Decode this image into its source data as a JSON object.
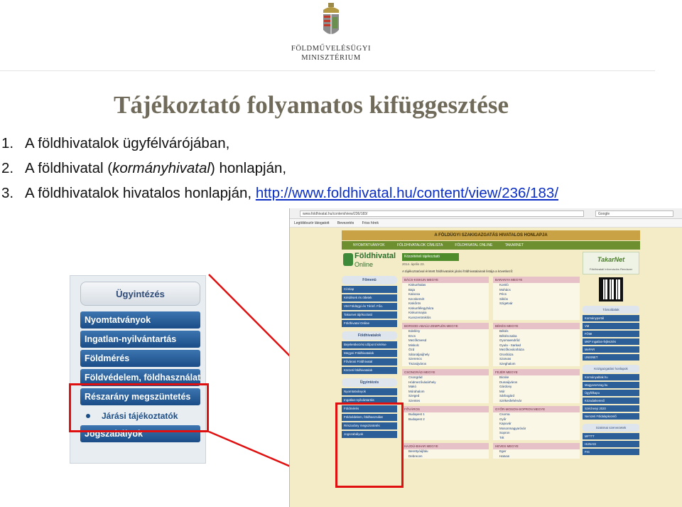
{
  "header": {
    "ministry_line1": "FÖLDMŰVELÉSÜGYI",
    "ministry_line2": "MINISZTÉRIUM"
  },
  "title": "Tájékoztató folyamatos kifüggesztése",
  "points": [
    {
      "num": "1.",
      "text": "A földhivatalok ügyfélvárójában,"
    },
    {
      "num": "2.",
      "before": "A földhivatal (",
      "italic": "kormányhivatal",
      "after": ") honlapján,"
    },
    {
      "num": "3.",
      "text": "A földhivatalok hivatalos honlapján, ",
      "link": "http://www.foldhivatal.hu/content/view/236/183/"
    }
  ],
  "zoom_panel": {
    "heading": "Ügyintézés",
    "buttons": [
      "Nyomtatványok",
      "Ingatlan-nyilvántartás",
      "Földmérés",
      "Földvédelem, földhasználat",
      "Részarány megszüntetés"
    ],
    "sub_item": "Járási tájékoztatók",
    "last_button": "Jogszabályok"
  },
  "screenshot": {
    "address": "www.foldhivatal.hu/content/view/236/183/",
    "search_placeholder": "Google",
    "bookmarks": [
      "Legtöbbször látogatott",
      "Bevezetés",
      "Friss hírek"
    ],
    "banner": "A FÖLDÜGYI SZAKIGAZGATÁS HIVATALOS HONLAPJA",
    "nav": [
      "NYOMTATVÁNYOK",
      "FÖLDHIVATALOK CÍMLISTA",
      "FÖLDHIVATAL ONLINE",
      "TAKARNET"
    ],
    "logo_line1": "Földhivatal",
    "logo_line2": "Online",
    "left_sections": [
      {
        "heading": "Főmenü",
        "items": [
          "Címlap",
          "Kérdések és ötletek",
          "VM Földügyi és Térinf. Főo.",
          "Takarnet tájékoztató",
          "Földhivatal Online"
        ]
      },
      {
        "heading": "Földhivatalok",
        "items": [
          "Bejelentkezési időpont kérése",
          "Megyei Földhivatalok",
          "Fővárosi Földhivatal",
          "Körzeti földhivatalok"
        ]
      },
      {
        "heading": "Ügyintézés",
        "items": [
          "Nyomtatványok",
          "Ingatlan-nyilvántartás",
          "Földmérés",
          "Földvédelem, földhasználat",
          "Részarány megszüntetés",
          "Jogszabályok"
        ]
      }
    ],
    "center": {
      "tab": "Közzétételi tájékoztató",
      "date": "2014. április 23.",
      "intro": "A tájékoztatóval érintett földhivatalok járási földhivatalainak listája a következő:",
      "counties": [
        {
          "name": "BÁCS-KISKUN MEGYE",
          "items": [
            "Kiskunhalas",
            "Baja",
            "Kalocsa",
            "Kecskemét",
            "Kiskőrös",
            "Kiskunfélegyháza",
            "Kiskunmajsa",
            "Kunszentmiklós"
          ]
        },
        {
          "name": "BARANYA MEGYE",
          "items": [
            "Komló",
            "Mohács",
            "Pécs",
            "Siklós",
            "Szigetvár"
          ]
        },
        {
          "name": "BORSOD-ABAÚJ-ZEMPLÉN MEGYE",
          "items": [
            "Edelény",
            "Encs",
            "Mezőkövesd",
            "Miskolc",
            "Ózd",
            "Sátoraljaújhely",
            "Szerencs",
            "Tiszaújváros"
          ]
        },
        {
          "name": "BÉKÉS MEGYE",
          "items": [
            "Békés",
            "Békéscsaba",
            "Gyomaendrőd",
            "Gyula - Sarkad",
            "Mezőkovácsháza",
            "Orosháza",
            "Szarvas",
            "Szeghalom"
          ]
        },
        {
          "name": "CSONGRÁD MEGYE",
          "items": [
            "Csongrád",
            "Hódmezővásárhely",
            "Makó",
            "Mórahalom",
            "Szeged",
            "Szentes"
          ]
        },
        {
          "name": "FEJÉR MEGYE",
          "items": [
            "Bicske",
            "Dunaújváros",
            "Gárdony",
            "Mór",
            "Sárbogárd",
            "Székesfehérvár"
          ]
        },
        {
          "name": "FŐVÁROS",
          "items": [
            "Budapest 1",
            "Budapest 2"
          ]
        },
        {
          "name": "GYŐR-MOSON-SOPRON MEGYE",
          "items": [
            "Csorna",
            "Győr",
            "Kapuvár",
            "Mosonmagyaróvár",
            "Sopron",
            "Tét"
          ]
        },
        {
          "name": "HAJDÚ-BIHAR MEGYE",
          "items": [
            "Berettyóújfalu",
            "Debrecen"
          ]
        },
        {
          "name": "HEVES MEGYE",
          "items": [
            "Eger",
            "Hatvan"
          ]
        }
      ]
    },
    "right": {
      "takarnet": "TakarNet",
      "takarnet_sub": "Földhivatali Információs Rendszer",
      "sections": [
        {
          "heading": "Társoldalak",
          "items": [
            "Kormányportál",
            "VM",
            "FÖMI",
            "MKP Ingatlan-fejlesztés",
            "MePAR",
            "UNISNET"
          ]
        },
        {
          "heading": "Közigazgatási honlapok",
          "items": [
            "Kormányablak.hu",
            "Magyarorszag.hu",
            "Ügyfélkapu",
            "Közadatkereső",
            "Széchenyi 2020",
            "Nemzeti Földalapkezelő"
          ]
        },
        {
          "heading": "Szakmai szervezetek",
          "items": [
            "MFTTT",
            "HUNAGI",
            "FIG"
          ]
        }
      ]
    }
  },
  "highlight_color": "#e01010"
}
